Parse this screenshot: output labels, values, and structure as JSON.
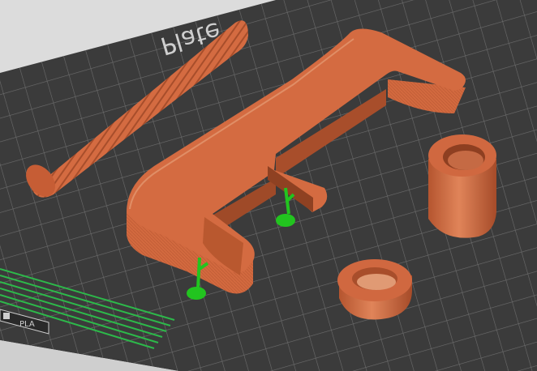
{
  "viewport": {
    "plate_label": "Plate",
    "material_label": "PLA",
    "icon": "printer-icon"
  },
  "colors": {
    "bed": "#3b3b3b",
    "grid": "#6c6c6c",
    "background": "#dcdcdc",
    "model": "#d2693f",
    "model_dark": "#a9502c",
    "model_light": "#e38a60",
    "support": "#22c41f",
    "edge": "#2db84a"
  },
  "objects": [
    {
      "name": "threaded-rod"
    },
    {
      "name": "c-clamp-frame"
    },
    {
      "name": "hex-nut"
    },
    {
      "name": "washer-ring"
    },
    {
      "name": "support-tree"
    }
  ]
}
